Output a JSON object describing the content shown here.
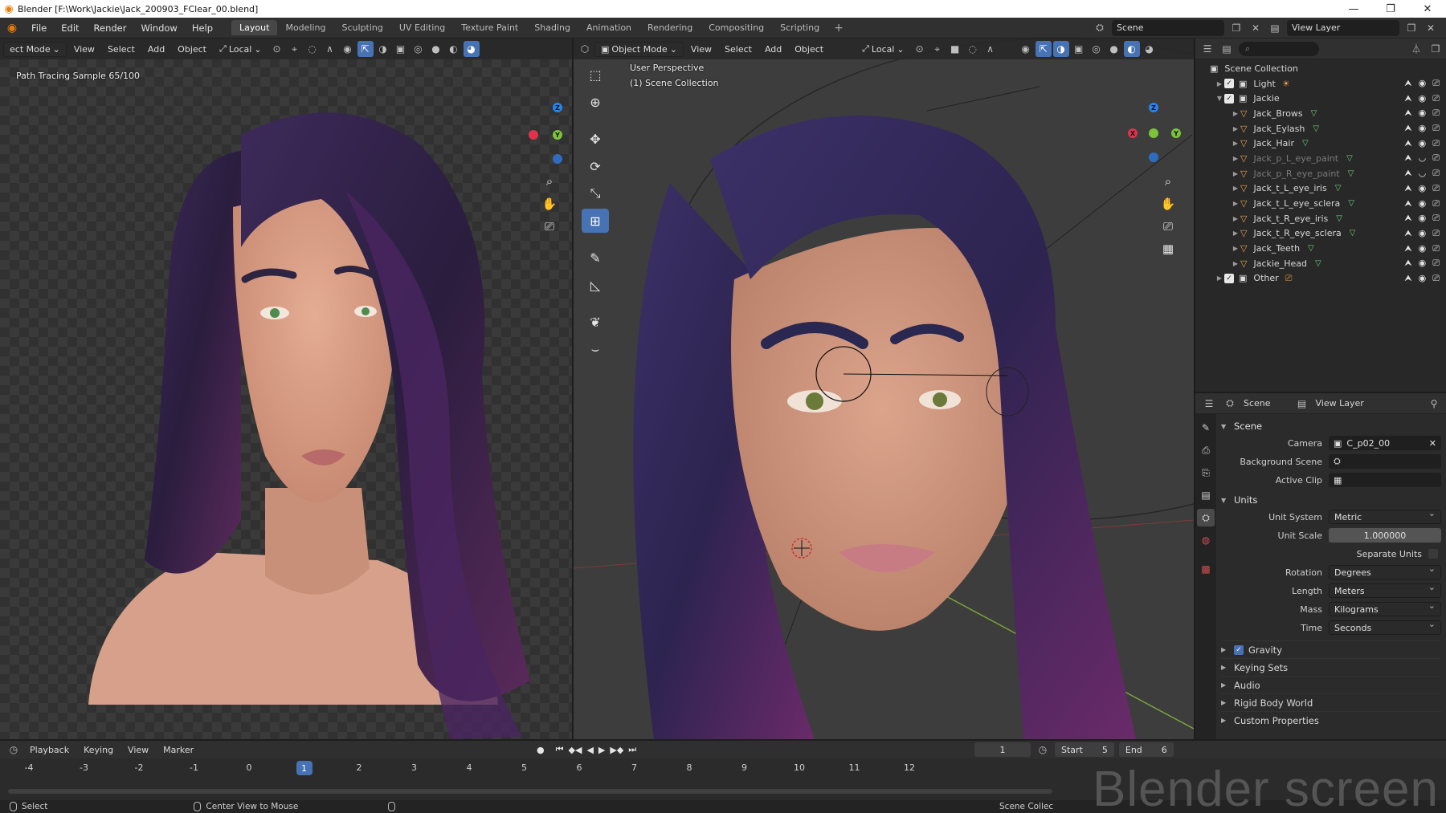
{
  "window": {
    "title": "Blender [F:\\Work\\Jackie\\Jack_200903_FClear_00.blend]",
    "controls": [
      "—",
      "❐",
      "✕"
    ]
  },
  "menu": [
    "File",
    "Edit",
    "Render",
    "Window",
    "Help"
  ],
  "workspaces": {
    "active": "Layout",
    "tabs": [
      "Layout",
      "Modeling",
      "Sculpting",
      "UV Editing",
      "Texture Paint",
      "Shading",
      "Animation",
      "Rendering",
      "Compositing",
      "Scripting"
    ]
  },
  "topright": {
    "scene": "Scene",
    "view_layer": "View Layer"
  },
  "left_viewport": {
    "mode": "ect Mode",
    "menus": [
      "View",
      "Select",
      "Add",
      "Object"
    ],
    "transform_orientation": "Local",
    "overlay_text": "Path Tracing Sample 65/100"
  },
  "right_viewport": {
    "mode": "Object Mode",
    "menus": [
      "View",
      "Select",
      "Add",
      "Object"
    ],
    "transform_orientation": "Local",
    "perspective_label": "User Perspective",
    "collection_label": "(1) Scene Collection",
    "tools": [
      "select-box",
      "cursor",
      "move",
      "rotate",
      "scale",
      "transform",
      "annotate",
      "measure",
      "add-cube",
      "bend"
    ]
  },
  "gizmo": {
    "x": "X",
    "y": "Y",
    "z": "Z"
  },
  "outliner": {
    "root": "Scene Collection",
    "rows": [
      {
        "name": "Light",
        "kind": "collection",
        "expanded": false,
        "dim": false
      },
      {
        "name": "Jackie",
        "kind": "collection",
        "expanded": true,
        "dim": false
      },
      {
        "name": "Jack_Brows",
        "kind": "object",
        "dim": false
      },
      {
        "name": "Jack_Eylash",
        "kind": "object",
        "dim": false
      },
      {
        "name": "Jack_Hair",
        "kind": "object",
        "dim": false
      },
      {
        "name": "Jack_p_L_eye_paint",
        "kind": "object",
        "dim": true
      },
      {
        "name": "Jack_p_R_eye_paint",
        "kind": "object",
        "dim": true
      },
      {
        "name": "Jack_t_L_eye_iris",
        "kind": "object",
        "dim": false
      },
      {
        "name": "Jack_t_L_eye_sclera",
        "kind": "object",
        "dim": false
      },
      {
        "name": "Jack_t_R_eye_iris",
        "kind": "object",
        "dim": false
      },
      {
        "name": "Jack_t_R_eye_sclera",
        "kind": "object",
        "dim": false
      },
      {
        "name": "Jack_Teeth",
        "kind": "object",
        "dim": false
      },
      {
        "name": "Jackie_Head",
        "kind": "object",
        "dim": false
      },
      {
        "name": "Other",
        "kind": "collection",
        "expanded": false,
        "dim": false
      }
    ]
  },
  "properties": {
    "header_scene": "Scene",
    "header_view_layer": "View Layer",
    "scene_panel": "Scene",
    "camera_label": "Camera",
    "camera_value": "C_p02_00",
    "background_scene_label": "Background Scene",
    "active_clip_label": "Active Clip",
    "units_panel": "Units",
    "unit_system_label": "Unit System",
    "unit_system": "Metric",
    "unit_scale_label": "Unit Scale",
    "unit_scale": "1.000000",
    "separate_units_label": "Separate Units",
    "rotation_label": "Rotation",
    "rotation": "Degrees",
    "length_label": "Length",
    "length": "Meters",
    "mass_label": "Mass",
    "mass": "Kilograms",
    "time_label": "Time",
    "time": "Seconds",
    "gravity": "Gravity",
    "keying_sets": "Keying Sets",
    "audio": "Audio",
    "rigid_body_world": "Rigid Body World",
    "custom_properties": "Custom Properties"
  },
  "timeline": {
    "menus": [
      "Playback",
      "Keying",
      "View",
      "Marker"
    ],
    "current_frame": "1",
    "start_label": "Start",
    "start": "5",
    "end_label": "End",
    "end": "6",
    "ticks": [
      "-4",
      "-3",
      "-2",
      "-1",
      "0",
      "1",
      "2",
      "3",
      "4",
      "5",
      "6",
      "7",
      "8",
      "9",
      "10",
      "11",
      "12"
    ]
  },
  "status": {
    "left": "Select",
    "middle": "Center View to Mouse",
    "right": "Scene Collec"
  },
  "watermark": "Blender screen",
  "colors": {
    "accent": "#4772b3",
    "hair_dark": "#2a1f3d",
    "skin": "#d9a189",
    "brand": "#e87d0d"
  }
}
